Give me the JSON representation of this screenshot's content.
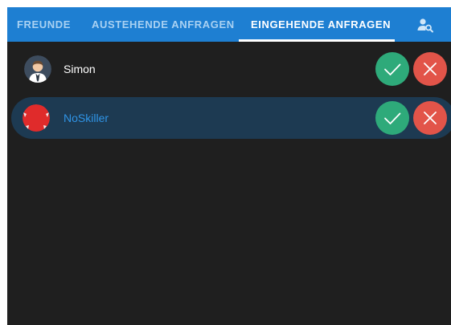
{
  "tabs": {
    "friends": "FREUNDE",
    "pending": "AUSTEHENDE ANFRAGEN",
    "incoming": "EINGEHENDE ANFRAGEN",
    "active": "incoming"
  },
  "header": {
    "search_icon": "user-search-icon"
  },
  "requests": [
    {
      "name": "Simon",
      "avatar": "businessman-avatar",
      "selected": false
    },
    {
      "name": "NoSkiller",
      "avatar": "red-disc-avatar",
      "selected": true
    }
  ],
  "actions": {
    "accept_icon": "check-icon",
    "decline_icon": "close-icon"
  },
  "colors": {
    "tab_bar": "#1e7fd2",
    "background": "#1f1f1f",
    "selected_row": "#1d3a52",
    "accept": "#2eaa7a",
    "decline": "#e25449",
    "highlight_text": "#2f94e6"
  }
}
